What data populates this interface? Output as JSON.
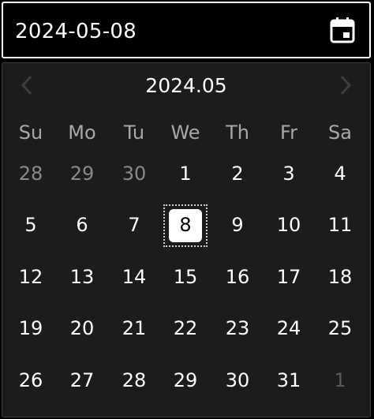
{
  "input": {
    "value": "2024-05-08"
  },
  "calendar": {
    "title": "2024.05",
    "weekdays": [
      "Su",
      "Mo",
      "Tu",
      "We",
      "Th",
      "Fr",
      "Sa"
    ],
    "weeks": [
      [
        "28",
        "29",
        "30",
        "1",
        "2",
        "3",
        "4"
      ],
      [
        "5",
        "6",
        "7",
        "8",
        "9",
        "10",
        "11"
      ],
      [
        "12",
        "13",
        "14",
        "15",
        "16",
        "17",
        "18"
      ],
      [
        "19",
        "20",
        "21",
        "22",
        "23",
        "24",
        "25"
      ],
      [
        "26",
        "27",
        "28",
        "29",
        "30",
        "31",
        "1"
      ]
    ],
    "selected": "8"
  },
  "colors": {
    "background": "#000000",
    "popup": "#1c1c1c",
    "selected_bg": "#ffffff",
    "muted_text": "#8a8a8a"
  },
  "icons": {
    "calendar": "calendar-icon",
    "prev": "chevron-left-icon",
    "next": "chevron-right-icon"
  }
}
